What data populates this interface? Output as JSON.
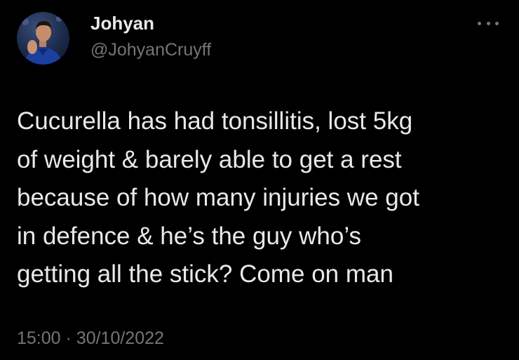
{
  "author": {
    "display_name": "Johyan",
    "handle": "@JohyanCruyff"
  },
  "tweet": {
    "text": "Cucurella has had tonsillitis, lost 5kg\nof weight & barely able to get a rest\nbecause of how many injuries we got\nin defence & he’s the guy who’s\ngetting all the stick? Come on man",
    "time": "15:00",
    "separator": "·",
    "date": "30/10/2022"
  },
  "icons": {
    "more": "more-horizontal-icon"
  },
  "colors": {
    "background": "#000000",
    "primary_text": "#e7e9ea",
    "secondary_text": "#71767b"
  }
}
